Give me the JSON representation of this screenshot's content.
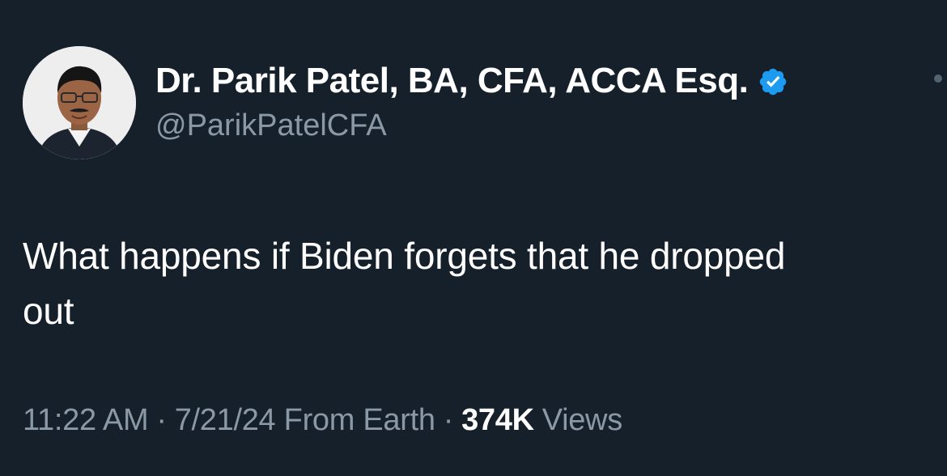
{
  "author": {
    "display_name": "Dr. Parik Patel, BA, CFA, ACCA Esq.",
    "handle": "@ParikPatelCFA",
    "verified": true,
    "verified_color": "#1d9bf0",
    "avatar_icon": "profile-photo"
  },
  "tweet": {
    "text_line1": "What happens if Biden forgets that he dropped",
    "text_line2": "out"
  },
  "meta": {
    "time": "11:22 AM",
    "separator": "·",
    "date": "7/21/24",
    "source": "From Earth",
    "views_count": "374K",
    "views_label": "Views"
  },
  "colors": {
    "background": "#15202b",
    "primary_text": "#ffffff",
    "secondary_text": "#8b98a5"
  }
}
